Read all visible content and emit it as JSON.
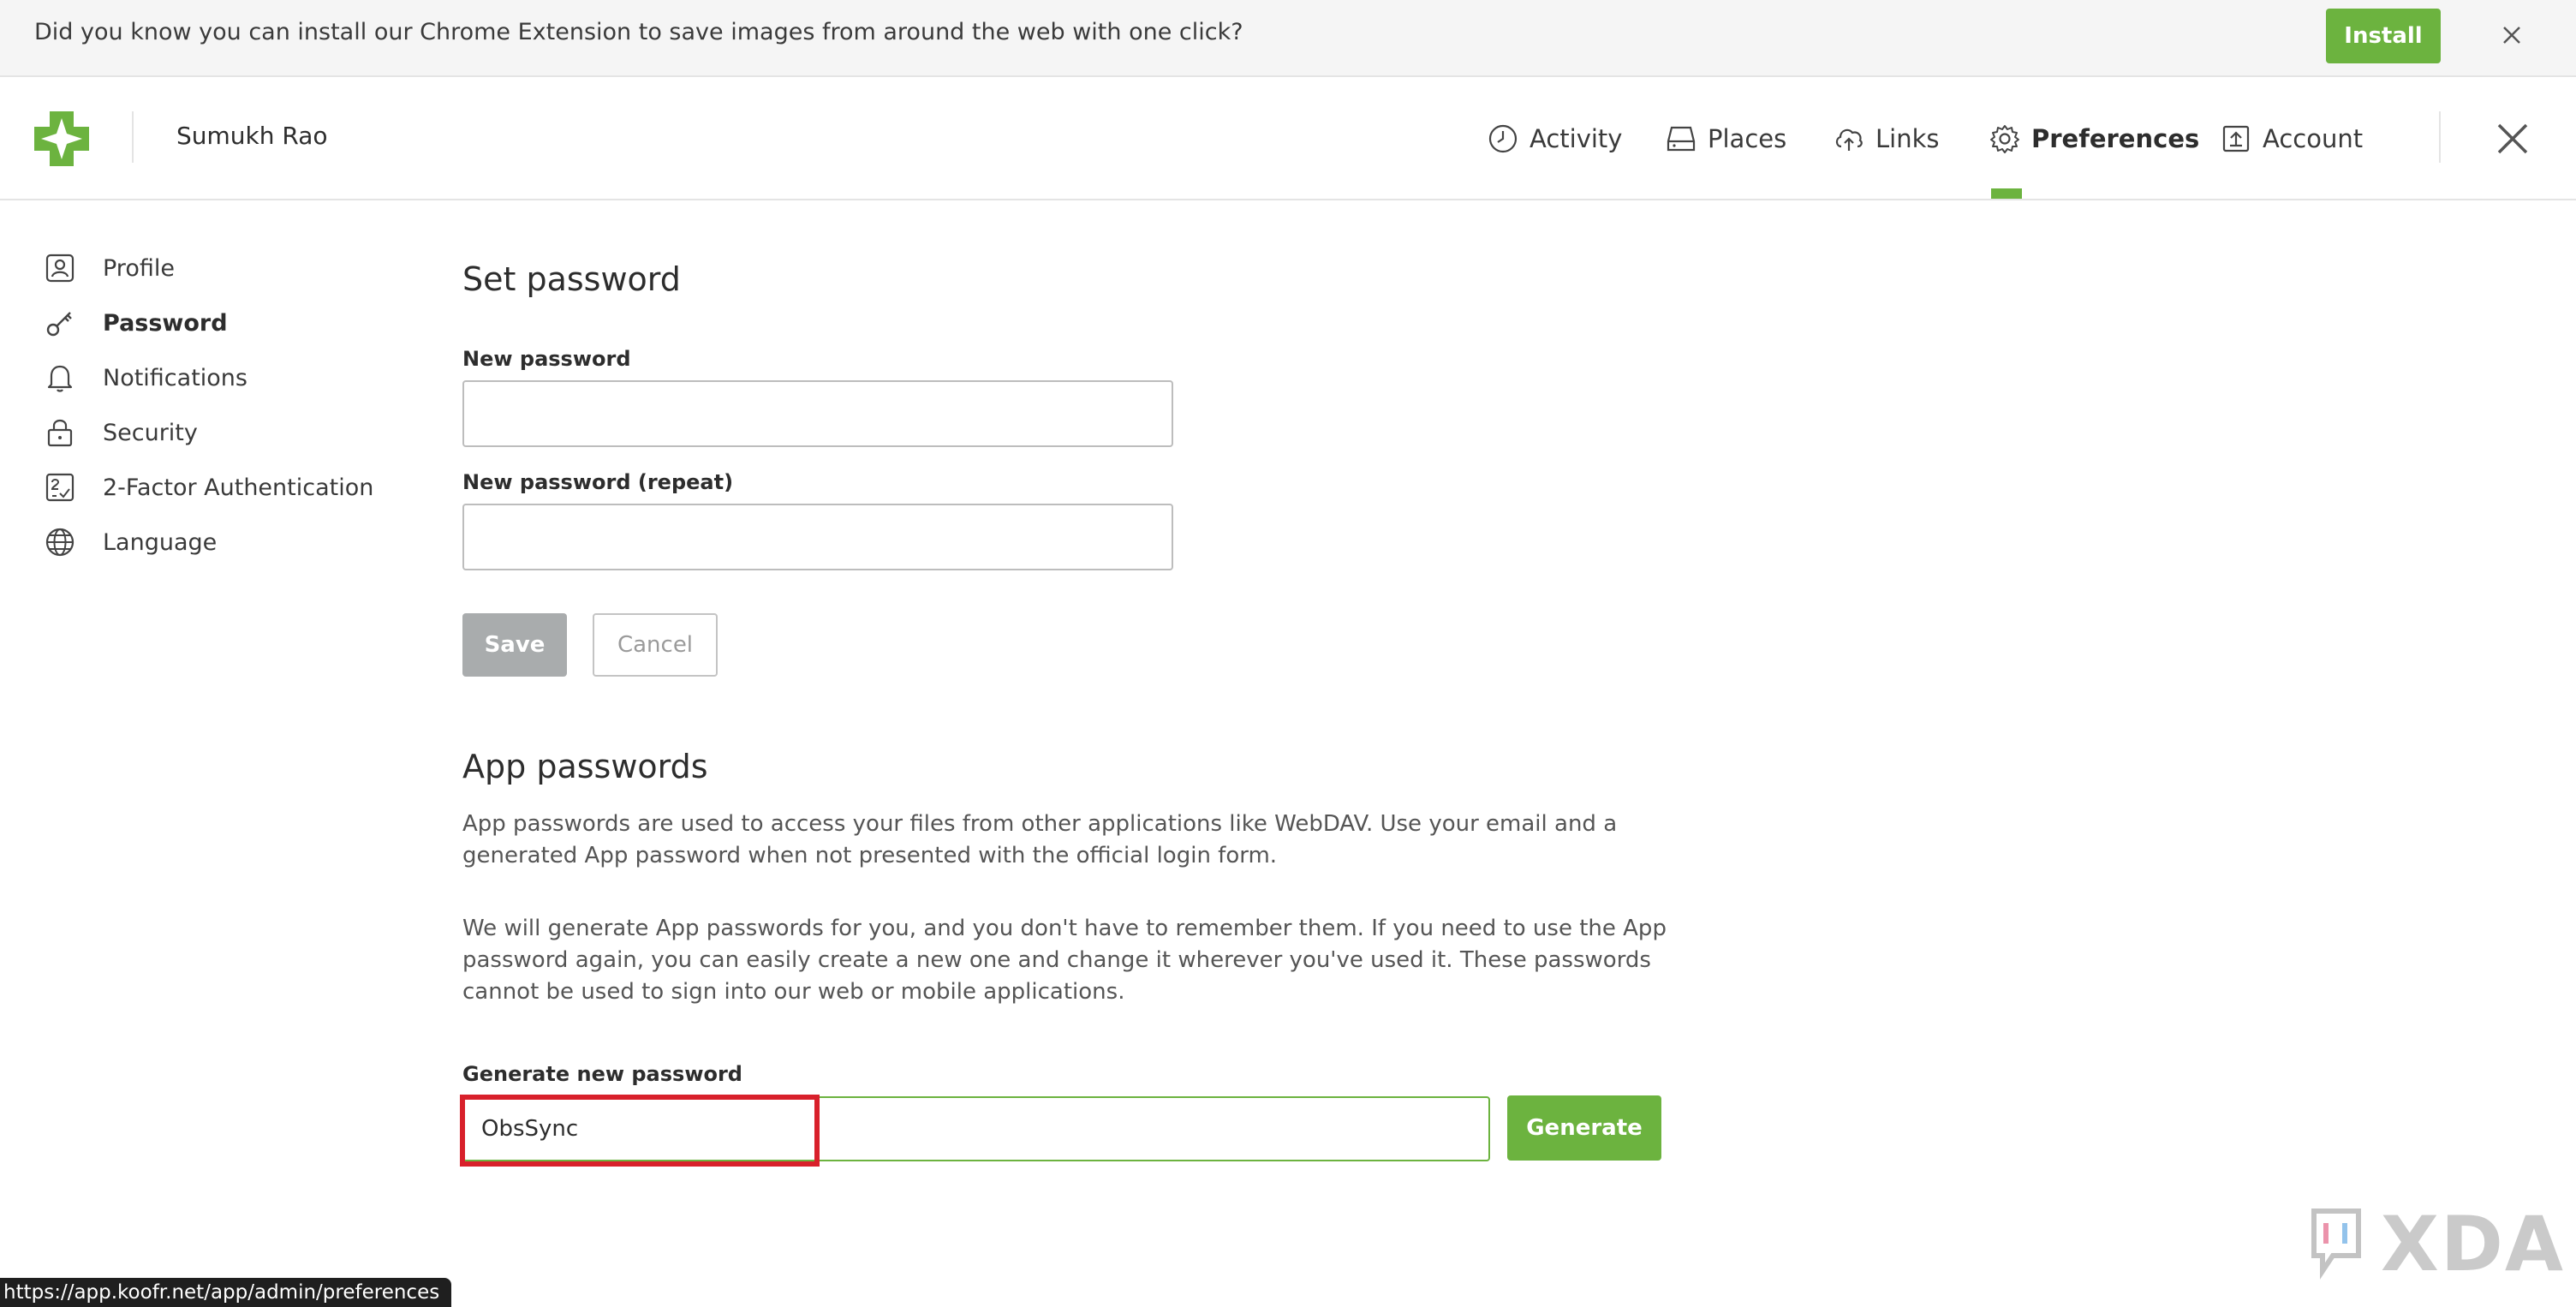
{
  "banner": {
    "text": "Did you know you can install our Chrome Extension to save images from around the web with one click?",
    "install_label": "Install"
  },
  "header": {
    "user_name": "Sumukh Rao",
    "nav": [
      {
        "label": "Activity",
        "icon": "clock-icon"
      },
      {
        "label": "Places",
        "icon": "drive-icon"
      },
      {
        "label": "Links",
        "icon": "cloud-upload-icon"
      },
      {
        "label": "Preferences",
        "icon": "gear-icon",
        "active": true
      },
      {
        "label": "Account",
        "icon": "upload-box-icon"
      }
    ]
  },
  "sidebar": {
    "items": [
      {
        "label": "Profile",
        "icon": "user-icon"
      },
      {
        "label": "Password",
        "icon": "key-icon",
        "active": true
      },
      {
        "label": "Notifications",
        "icon": "bell-icon"
      },
      {
        "label": "Security",
        "icon": "lock-icon"
      },
      {
        "label": "2-Factor Authentication",
        "icon": "two-factor-icon"
      },
      {
        "label": "Language",
        "icon": "globe-icon"
      }
    ]
  },
  "password_form": {
    "title": "Set password",
    "new_label": "New password",
    "new_value": "",
    "repeat_label": "New password (repeat)",
    "repeat_value": "",
    "save_label": "Save",
    "cancel_label": "Cancel"
  },
  "app_passwords": {
    "title": "App passwords",
    "para1": "App passwords are used to access your files from other applications like WebDAV. Use your email and a generated App password when not presented with the official login form.",
    "para2": "We will generate App passwords for you, and you don't have to remember them. If you need to use the App password again, you can easily create a new one and change it wherever you've used it. These passwords cannot be used to sign into our web or mobile applications.",
    "generate_label": "Generate new password",
    "generate_value": "ObsSync",
    "generate_button": "Generate"
  },
  "status_url": "https://app.koofr.net/app/admin/preferences",
  "watermark": "XDA",
  "colors": {
    "accent": "#6cb33f",
    "highlight": "#d8202b"
  }
}
